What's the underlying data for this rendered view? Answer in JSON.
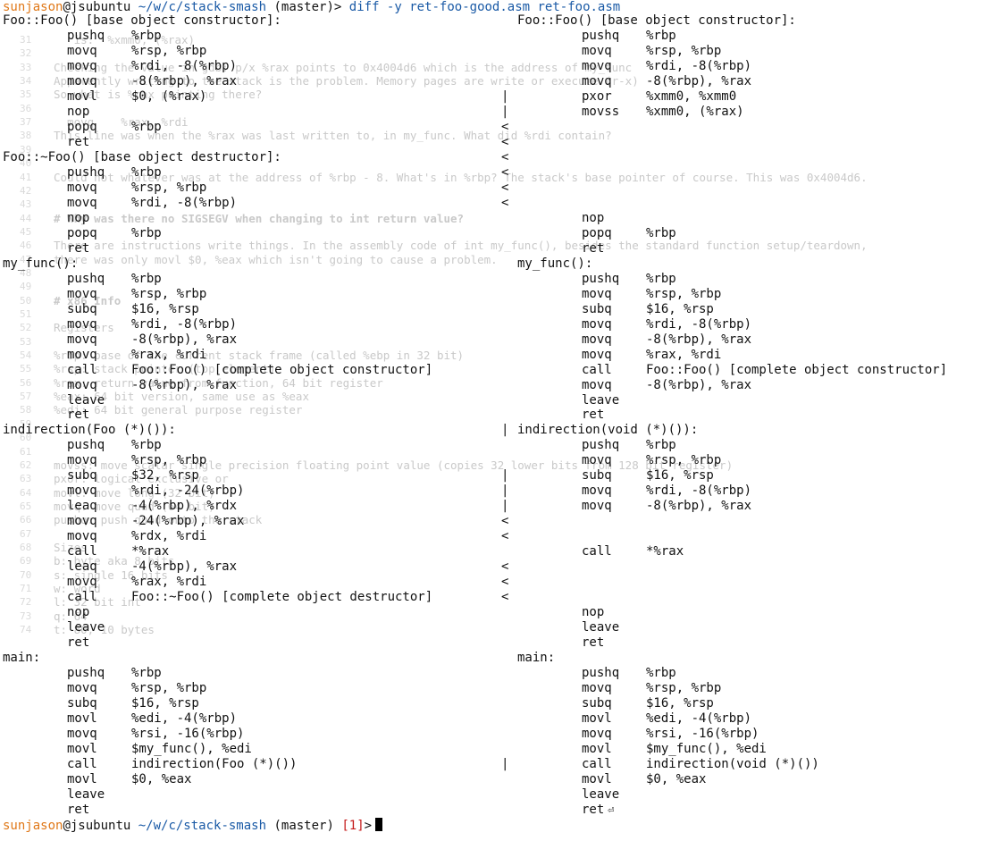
{
  "prompt_top": {
    "user": "sunjason",
    "host": "@jsubuntu",
    "path": "~/w/c/stack-smash",
    "branch": "(master)",
    "arrow": ">",
    "command": "diff -y ret-foo-good.asm ret-foo.asm"
  },
  "prompt_bottom": {
    "user": "sunjason",
    "host": "@jsubuntu",
    "path": "~/w/c/stack-smash",
    "branch": "(master)",
    "status": "[1]",
    "arrow": ">"
  },
  "ghost": [
    {
      "num": "31",
      "text": "   is:  %xmm0, (%rax)",
      "bold": false
    },
    {
      "num": "32",
      "text": "",
      "bold": false
    },
    {
      "num": "33",
      "text": "Checking the value in gdb: p/x %rax points to 0x4004d6 which is the address of my_func",
      "bold": false
    },
    {
      "num": "34",
      "text": "Apparently writing to the stack is the problem. Memory pages are write or execute (r-x)",
      "bold": false
    },
    {
      "num": "35",
      "text": "So what is %rax pointing there?",
      "bold": false
    },
    {
      "num": "36",
      "text": "",
      "bold": false
    },
    {
      "num": "37",
      "text": "  movq    %rax, %rdi",
      "bold": false
    },
    {
      "num": "38",
      "text": "This line was when the %rax was last written to, in my_func. What did %rdi contain?",
      "bold": false
    },
    {
      "num": "39",
      "text": "",
      "bold": false
    },
    {
      "num": "40",
      "text": "",
      "bold": false
    },
    {
      "num": "41",
      "text": "Could not whatever was at the address of %rbp - 8. What's in %rbp? The stack's base pointer of course. This was 0x4004d6.",
      "bold": false
    },
    {
      "num": "42",
      "text": "",
      "bold": false
    },
    {
      "num": "43",
      "text": "",
      "bold": false
    },
    {
      "num": "44",
      "text": "# Why was there no SIGSEGV when changing to int return value?",
      "bold": true
    },
    {
      "num": "45",
      "text": "",
      "bold": false
    },
    {
      "num": "46",
      "text": "There are instructions write things. In the assembly code of int my_func(), besides the standard function setup/teardown,",
      "bold": false
    },
    {
      "num": "47",
      "text": "there was only movl $0, %eax which isn't going to cause a problem.",
      "bold": false
    },
    {
      "num": "48",
      "text": "",
      "bold": false
    },
    {
      "num": "49",
      "text": "",
      "bold": false
    },
    {
      "num": "50",
      "text": "# x86 Info",
      "bold": true
    },
    {
      "num": "51",
      "text": "",
      "bold": false
    },
    {
      "num": "52",
      "text": "Registers",
      "bold": false
    },
    {
      "num": "53",
      "text": "",
      "bold": false
    },
    {
      "num": "54",
      "text": "%rbp: base of the current stack frame (called %ebp in 32 bit)",
      "bold": false
    },
    {
      "num": "55",
      "text": "%rsp: stack pointer (top element)",
      "bold": false
    },
    {
      "num": "56",
      "text": "%rax: return value from function, 64 bit register",
      "bold": false
    },
    {
      "num": "57",
      "text": "%eax: 64 bit version, same use as %eax",
      "bold": false
    },
    {
      "num": "58",
      "text": "%edi: 64 bit general purpose register",
      "bold": false
    },
    {
      "num": "59",
      "text": "",
      "bold": false
    },
    {
      "num": "60",
      "text": "",
      "bold": false
    },
    {
      "num": "61",
      "text": "",
      "bold": false
    },
    {
      "num": "62",
      "text": "movss: move scalar single precision floating point value (copies 32 lower bits from 128 bit register)",
      "bold": false
    },
    {
      "num": "63",
      "text": "pxor: logical exclusive or",
      "bold": false
    },
    {
      "num": "64",
      "text": "movl: move long (32 bit)",
      "bold": false
    },
    {
      "num": "65",
      "text": "movq: move quad (64 bit)",
      "bold": false
    },
    {
      "num": "66",
      "text": "pushq: push quad onto the stack",
      "bold": false
    },
    {
      "num": "67",
      "text": "",
      "bold": false
    },
    {
      "num": "68",
      "text": "Sizes",
      "bold": false
    },
    {
      "num": "69",
      "text": "b: byte aka 8 bits",
      "bold": false
    },
    {
      "num": "70",
      "text": "s: single 16 bits",
      "bold": false
    },
    {
      "num": "71",
      "text": "w: word",
      "bold": false
    },
    {
      "num": "72",
      "text": "l: 32 bit int",
      "bold": false
    },
    {
      "num": "73",
      "text": "q: 64",
      "bold": false
    },
    {
      "num": "74",
      "text": "t: 80, 10 bytes",
      "bold": false
    }
  ],
  "diff_rows": [
    {
      "ll": "Foo::Foo() [base object constructor]:",
      "lm": "",
      "lo": "",
      "mk": "",
      "rl": "Foo::Foo() [base object constructor]:",
      "rm": "",
      "ro": ""
    },
    {
      "ll": "",
      "lm": "pushq",
      "lo": "%rbp",
      "mk": "",
      "rl": "",
      "rm": "pushq",
      "ro": "%rbp"
    },
    {
      "ll": "",
      "lm": "movq",
      "lo": "%rsp, %rbp",
      "mk": "",
      "rl": "",
      "rm": "movq",
      "ro": "%rsp, %rbp"
    },
    {
      "ll": "",
      "lm": "movq",
      "lo": "%rdi, -8(%rbp)",
      "mk": "",
      "rl": "",
      "rm": "movq",
      "ro": "%rdi, -8(%rbp)"
    },
    {
      "ll": "",
      "lm": "movq",
      "lo": "-8(%rbp), %rax",
      "mk": "",
      "rl": "",
      "rm": "movq",
      "ro": "-8(%rbp), %rax"
    },
    {
      "ll": "",
      "lm": "movl",
      "lo": "$0, (%rax)",
      "mk": "|",
      "rl": "",
      "rm": "pxor",
      "ro": "%xmm0, %xmm0"
    },
    {
      "ll": "",
      "lm": "nop",
      "lo": "",
      "mk": "|",
      "rl": "",
      "rm": "movss",
      "ro": "%xmm0, (%rax)"
    },
    {
      "ll": "",
      "lm": "popq",
      "lo": "%rbp",
      "mk": "<",
      "rl": "",
      "rm": "",
      "ro": ""
    },
    {
      "ll": "",
      "lm": "ret",
      "lo": "",
      "mk": "<",
      "rl": "",
      "rm": "",
      "ro": ""
    },
    {
      "ll": "Foo::~Foo() [base object destructor]:",
      "lm": "",
      "lo": "",
      "mk": "<",
      "rl": "",
      "rm": "",
      "ro": ""
    },
    {
      "ll": "",
      "lm": "pushq",
      "lo": "%rbp",
      "mk": "<",
      "rl": "",
      "rm": "",
      "ro": ""
    },
    {
      "ll": "",
      "lm": "movq",
      "lo": "%rsp, %rbp",
      "mk": "<",
      "rl": "",
      "rm": "",
      "ro": ""
    },
    {
      "ll": "",
      "lm": "movq",
      "lo": "%rdi, -8(%rbp)",
      "mk": "<",
      "rl": "",
      "rm": "",
      "ro": ""
    },
    {
      "ll": "",
      "lm": "nop",
      "lo": "",
      "mk": "",
      "rl": "",
      "rm": "nop",
      "ro": ""
    },
    {
      "ll": "",
      "lm": "popq",
      "lo": "%rbp",
      "mk": "",
      "rl": "",
      "rm": "popq",
      "ro": "%rbp"
    },
    {
      "ll": "",
      "lm": "ret",
      "lo": "",
      "mk": "",
      "rl": "",
      "rm": "ret",
      "ro": ""
    },
    {
      "ll": "my_func():",
      "lm": "",
      "lo": "",
      "mk": "",
      "rl": "my_func():",
      "rm": "",
      "ro": ""
    },
    {
      "ll": "",
      "lm": "pushq",
      "lo": "%rbp",
      "mk": "",
      "rl": "",
      "rm": "pushq",
      "ro": "%rbp"
    },
    {
      "ll": "",
      "lm": "movq",
      "lo": "%rsp, %rbp",
      "mk": "",
      "rl": "",
      "rm": "movq",
      "ro": "%rsp, %rbp"
    },
    {
      "ll": "",
      "lm": "subq",
      "lo": "$16, %rsp",
      "mk": "",
      "rl": "",
      "rm": "subq",
      "ro": "$16, %rsp"
    },
    {
      "ll": "",
      "lm": "movq",
      "lo": "%rdi, -8(%rbp)",
      "mk": "",
      "rl": "",
      "rm": "movq",
      "ro": "%rdi, -8(%rbp)"
    },
    {
      "ll": "",
      "lm": "movq",
      "lo": "-8(%rbp), %rax",
      "mk": "",
      "rl": "",
      "rm": "movq",
      "ro": "-8(%rbp), %rax"
    },
    {
      "ll": "",
      "lm": "movq",
      "lo": "%rax, %rdi",
      "mk": "",
      "rl": "",
      "rm": "movq",
      "ro": "%rax, %rdi"
    },
    {
      "ll": "",
      "lm": "call",
      "lo": "Foo::Foo() [complete object constructor]",
      "mk": "",
      "rl": "",
      "rm": "call",
      "ro": "Foo::Foo() [complete object constructor]"
    },
    {
      "ll": "",
      "lm": "movq",
      "lo": "-8(%rbp), %rax",
      "mk": "",
      "rl": "",
      "rm": "movq",
      "ro": "-8(%rbp), %rax"
    },
    {
      "ll": "",
      "lm": "leave",
      "lo": "",
      "mk": "",
      "rl": "",
      "rm": "leave",
      "ro": ""
    },
    {
      "ll": "",
      "lm": "ret",
      "lo": "",
      "mk": "",
      "rl": "",
      "rm": "ret",
      "ro": ""
    },
    {
      "ll": "indirection(Foo (*)()):",
      "lm": "",
      "lo": "",
      "mk": "|",
      "rl": "indirection(void (*)()):",
      "rm": "",
      "ro": ""
    },
    {
      "ll": "",
      "lm": "pushq",
      "lo": "%rbp",
      "mk": "",
      "rl": "",
      "rm": "pushq",
      "ro": "%rbp"
    },
    {
      "ll": "",
      "lm": "movq",
      "lo": "%rsp, %rbp",
      "mk": "",
      "rl": "",
      "rm": "movq",
      "ro": "%rsp, %rbp"
    },
    {
      "ll": "",
      "lm": "subq",
      "lo": "$32, %rsp",
      "mk": "|",
      "rl": "",
      "rm": "subq",
      "ro": "$16, %rsp"
    },
    {
      "ll": "",
      "lm": "movq",
      "lo": "%rdi, -24(%rbp)",
      "mk": "|",
      "rl": "",
      "rm": "movq",
      "ro": "%rdi, -8(%rbp)"
    },
    {
      "ll": "",
      "lm": "leaq",
      "lo": "-4(%rbp), %rdx",
      "mk": "|",
      "rl": "",
      "rm": "movq",
      "ro": "-8(%rbp), %rax"
    },
    {
      "ll": "",
      "lm": "movq",
      "lo": "-24(%rbp), %rax",
      "mk": "<",
      "rl": "",
      "rm": "",
      "ro": ""
    },
    {
      "ll": "",
      "lm": "movq",
      "lo": "%rdx, %rdi",
      "mk": "<",
      "rl": "",
      "rm": "",
      "ro": ""
    },
    {
      "ll": "",
      "lm": "call",
      "lo": "*%rax",
      "mk": "",
      "rl": "",
      "rm": "call",
      "ro": "*%rax"
    },
    {
      "ll": "",
      "lm": "leaq",
      "lo": "-4(%rbp), %rax",
      "mk": "<",
      "rl": "",
      "rm": "",
      "ro": ""
    },
    {
      "ll": "",
      "lm": "movq",
      "lo": "%rax, %rdi",
      "mk": "<",
      "rl": "",
      "rm": "",
      "ro": ""
    },
    {
      "ll": "",
      "lm": "call",
      "lo": "Foo::~Foo() [complete object destructor]",
      "mk": "<",
      "rl": "",
      "rm": "",
      "ro": ""
    },
    {
      "ll": "",
      "lm": "nop",
      "lo": "",
      "mk": "",
      "rl": "",
      "rm": "nop",
      "ro": ""
    },
    {
      "ll": "",
      "lm": "leave",
      "lo": "",
      "mk": "",
      "rl": "",
      "rm": "leave",
      "ro": ""
    },
    {
      "ll": "",
      "lm": "ret",
      "lo": "",
      "mk": "",
      "rl": "",
      "rm": "ret",
      "ro": ""
    },
    {
      "ll": "main:",
      "lm": "",
      "lo": "",
      "mk": "",
      "rl": "main:",
      "rm": "",
      "ro": ""
    },
    {
      "ll": "",
      "lm": "pushq",
      "lo": "%rbp",
      "mk": "",
      "rl": "",
      "rm": "pushq",
      "ro": "%rbp"
    },
    {
      "ll": "",
      "lm": "movq",
      "lo": "%rsp, %rbp",
      "mk": "",
      "rl": "",
      "rm": "movq",
      "ro": "%rsp, %rbp"
    },
    {
      "ll": "",
      "lm": "subq",
      "lo": "$16, %rsp",
      "mk": "",
      "rl": "",
      "rm": "subq",
      "ro": "$16, %rsp"
    },
    {
      "ll": "",
      "lm": "movl",
      "lo": "%edi, -4(%rbp)",
      "mk": "",
      "rl": "",
      "rm": "movl",
      "ro": "%edi, -4(%rbp)"
    },
    {
      "ll": "",
      "lm": "movq",
      "lo": "%rsi, -16(%rbp)",
      "mk": "",
      "rl": "",
      "rm": "movq",
      "ro": "%rsi, -16(%rbp)"
    },
    {
      "ll": "",
      "lm": "movl",
      "lo": "$my_func(), %edi",
      "mk": "",
      "rl": "",
      "rm": "movl",
      "ro": "$my_func(), %edi"
    },
    {
      "ll": "",
      "lm": "call",
      "lo": "indirection(Foo (*)())",
      "mk": "|",
      "rl": "",
      "rm": "call",
      "ro": "indirection(void (*)())"
    },
    {
      "ll": "",
      "lm": "movl",
      "lo": "$0, %eax",
      "mk": "",
      "rl": "",
      "rm": "movl",
      "ro": "$0, %eax"
    },
    {
      "ll": "",
      "lm": "leave",
      "lo": "",
      "mk": "",
      "rl": "",
      "rm": "leave",
      "ro": ""
    },
    {
      "ll": "",
      "lm": "ret",
      "lo": "",
      "mk": "",
      "rl": "",
      "rm": "ret",
      "ro": ""
    }
  ],
  "colors": {
    "user": "#e07818",
    "path": "#1a5aa6",
    "status": "#c41a1a",
    "ghost_text": "#c9c9c9"
  },
  "icons": {
    "return_marker": "return-arrow-icon"
  }
}
